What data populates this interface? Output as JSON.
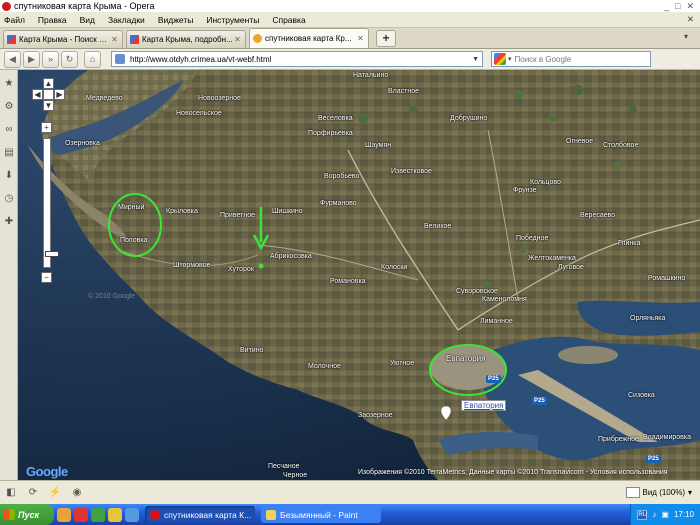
{
  "window": {
    "title": "спутниковая карта Крыма - Opera",
    "controls": [
      "_",
      "□",
      "✕"
    ]
  },
  "menu": {
    "items": [
      "Файл",
      "Правка",
      "Вид",
      "Закладки",
      "Виджеты",
      "Инструменты",
      "Справка"
    ],
    "close": "✕"
  },
  "tabs": [
    {
      "label": "Карта Крыма - Поиск в ...",
      "favicon": "google-icon",
      "active": false
    },
    {
      "label": "Карта Крыма, подробн...",
      "favicon": "google-icon",
      "active": false
    },
    {
      "label": "спутниковая карта Кр...",
      "favicon": "site-icon",
      "active": true
    }
  ],
  "newtab": "+",
  "nav": {
    "url": "http://www.otdyh.crimea.ua/vt-webf.html",
    "search_placeholder": "Поиск в Google"
  },
  "map": {
    "labels_main": [
      {
        "text": "Медведево"
      },
      {
        "text": "Новоозерное"
      },
      {
        "text": "Озерновка"
      },
      {
        "text": "Мирный"
      },
      {
        "text": "Крыловка"
      },
      {
        "text": "Поповка"
      },
      {
        "text": "Приветное"
      },
      {
        "text": "Шишкино"
      },
      {
        "text": "Абрикосовка"
      },
      {
        "text": "Штормовое"
      },
      {
        "text": "Хуторок"
      },
      {
        "text": "Витино"
      },
      {
        "text": "Молочное"
      },
      {
        "text": "Уютное"
      },
      {
        "text": "Евпатория"
      },
      {
        "text": "Заозерное"
      },
      {
        "text": "Веселовка"
      },
      {
        "text": "Порфирьевка"
      },
      {
        "text": "Шаумян"
      },
      {
        "text": "Воробьево"
      },
      {
        "text": "Известковое"
      },
      {
        "text": "Фрунзе"
      },
      {
        "text": "Фурманово"
      },
      {
        "text": "Колоски"
      },
      {
        "text": "Романовка"
      },
      {
        "text": "Великое"
      },
      {
        "text": "Добрушино"
      },
      {
        "text": "Огневое"
      },
      {
        "text": "Кольцово"
      },
      {
        "text": "Столбовое"
      },
      {
        "text": "Победное"
      },
      {
        "text": "Вересаево"
      },
      {
        "text": "Глинка"
      },
      {
        "text": "Луговое"
      },
      {
        "text": "Суворовское"
      },
      {
        "text": "Каменоломня"
      },
      {
        "text": "Лиманное"
      },
      {
        "text": "Орляньяка"
      },
      {
        "text": "Прибрежное"
      },
      {
        "text": "Владимировка"
      },
      {
        "text": "Сизовка"
      },
      {
        "text": "Черное"
      },
      {
        "text": "Песчаное"
      },
      {
        "text": "Натальино"
      },
      {
        "text": "Властное"
      },
      {
        "text": "Новосельское"
      },
      {
        "text": "Желтокаменка"
      },
      {
        "text": "Ромашкино"
      }
    ],
    "road_labels": [
      "P25",
      "P25",
      "P25"
    ],
    "place_tag": "Евпатория",
    "copyright": "Изображения ©2010 TerraMetrics, Данные карты ©2010 Transnavicom - Условия использования",
    "google_logo": "Google",
    "faded_watermark": "© 2010 Google",
    "zoom_plus": "+",
    "zoom_minus": "−",
    "pan_up": "▲",
    "pan_down": "▼",
    "pan_left": "◀",
    "pan_right": "▶"
  },
  "status": {
    "zoom": "Вид (100%)"
  },
  "taskbar": {
    "start": "Пуск",
    "tasks": [
      {
        "label": "спутниковая карта К...",
        "active": true
      },
      {
        "label": "Безымянный - Paint",
        "active": false
      }
    ],
    "lang": "RU",
    "time": "17:10"
  },
  "colors": {
    "sea_deep": "#1f3b5a",
    "land": "#6c6a4e",
    "highlight_circle": "#39e636",
    "road_badge": "#1c5fb5",
    "taskbar": "#245edb"
  }
}
